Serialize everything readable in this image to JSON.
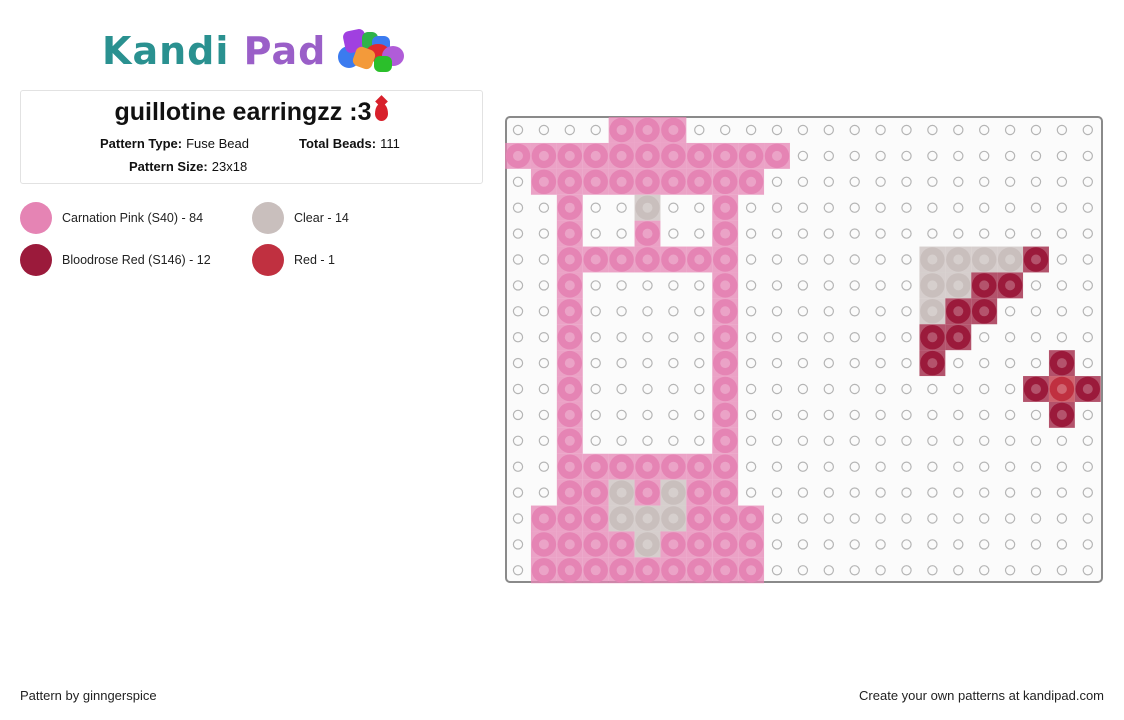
{
  "brand": {
    "name_part1": "Kandi",
    "name_part2": "Pad",
    "logo_icon": "bead-pile-icon"
  },
  "pattern": {
    "title": "guillotine earringzz :3",
    "title_emoji": "blood-drop-icon",
    "type_label": "Pattern Type:",
    "type_value": "Fuse Bead",
    "total_label": "Total Beads:",
    "total_value": "111",
    "size_label": "Pattern Size:",
    "size_value": "23x18"
  },
  "legend": [
    {
      "label": "Carnation Pink (S40) - 84",
      "color": "#e584b4",
      "key": "P"
    },
    {
      "label": "Clear - 14",
      "color": "#c9bfbd",
      "key": "C"
    },
    {
      "label": "Bloodrose Red (S146) - 12",
      "color": "#9b1a3b",
      "key": "B"
    },
    {
      "label": "Red - 1",
      "color": "#c03040",
      "key": "R"
    }
  ],
  "grid": {
    "columns": 23,
    "rows": 18,
    "cells": [
      "....PPP................",
      "PPPPPPPPPPP............",
      ".PPPPPPPPP.............",
      "..P..C..P..............",
      "..P..P..P..............",
      "..PPPPPPP.......CCCCB..",
      "..P.....P.......CCBB...",
      "..P.....P.......CBB....",
      "..P.....P.......BB.....",
      "..P.....P.......B....B.",
      "..P.....P...........BRB",
      "..P.....P............B.",
      "..P.....P..............",
      "..PPPPPPP..............",
      "..PPCPCPP..............",
      ".PPPCCCPPP.............",
      ".PPPPCPPPP.............",
      ".PPPPPPPPP............."
    ]
  },
  "footer": {
    "author": "Pattern by ginngerspice",
    "cta": "Create your own patterns at kandipad.com"
  }
}
